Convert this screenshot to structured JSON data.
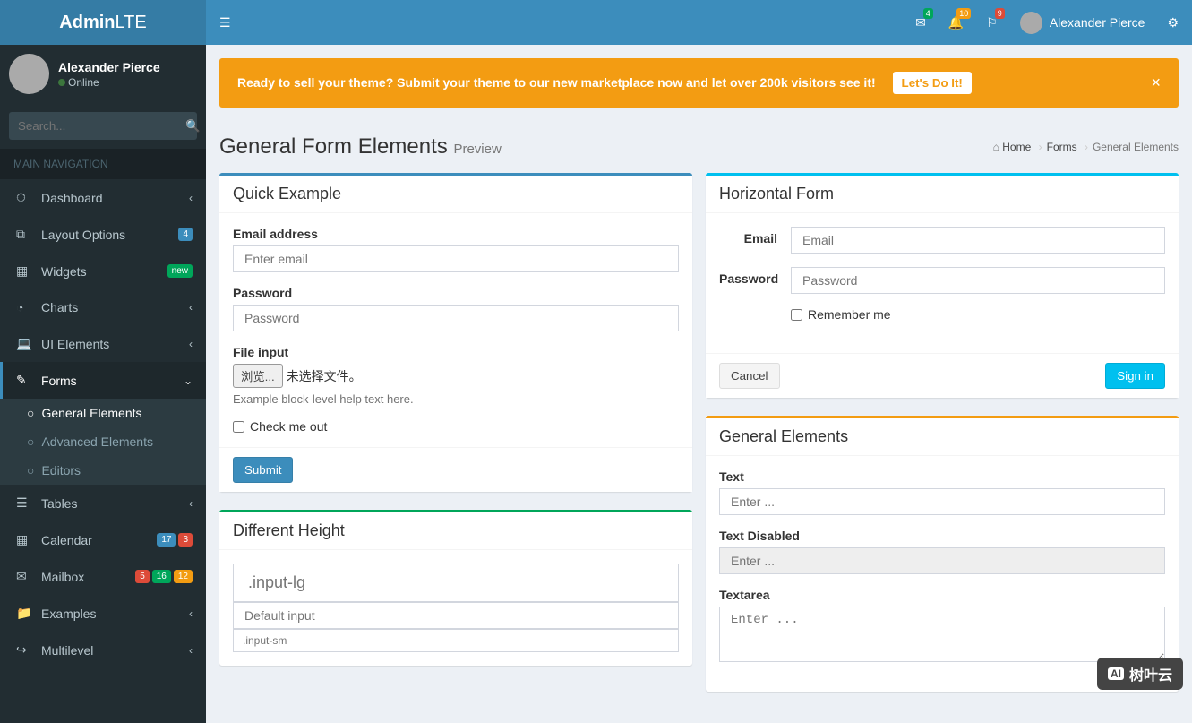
{
  "brand": {
    "prefix": "Admin",
    "suffix": "LTE"
  },
  "user": {
    "name": "Alexander Pierce",
    "status": "Online"
  },
  "search": {
    "placeholder": "Search..."
  },
  "nav_header": "MAIN NAVIGATION",
  "sidebar": {
    "items": [
      {
        "label": "Dashboard",
        "icon": "⚙"
      },
      {
        "label": "Layout Options",
        "icon": "⧉",
        "badge": "4",
        "badge_cls": "bg-blue"
      },
      {
        "label": "Widgets",
        "icon": "▦",
        "badge": "new",
        "badge_cls": "bg-green"
      },
      {
        "label": "Charts",
        "icon": "◔"
      },
      {
        "label": "UI Elements",
        "icon": "💻"
      },
      {
        "label": "Forms",
        "icon": "✎"
      },
      {
        "label": "Tables",
        "icon": "☰"
      },
      {
        "label": "Calendar",
        "icon": "📅",
        "badges": [
          [
            "17",
            "bg-blue"
          ],
          [
            "3",
            "bg-red"
          ]
        ]
      },
      {
        "label": "Mailbox",
        "icon": "✉",
        "badges": [
          [
            "5",
            "bg-red"
          ],
          [
            "16",
            "bg-green"
          ],
          [
            "12",
            "bg-yellow"
          ]
        ]
      },
      {
        "label": "Examples",
        "icon": "📁"
      },
      {
        "label": "Multilevel",
        "icon": "↪"
      }
    ],
    "forms_sub": [
      {
        "label": "General Elements"
      },
      {
        "label": "Advanced Elements"
      },
      {
        "label": "Editors"
      }
    ]
  },
  "topnav": {
    "mail_badge": "4",
    "bell_badge": "10",
    "flag_badge": "9",
    "username": "Alexander Pierce"
  },
  "alert": {
    "msg": "Ready to sell your theme? Submit your theme to our new marketplace now and let over 200k visitors see it!",
    "btn": "Let's Do It!"
  },
  "page": {
    "title": "General Form Elements",
    "subtitle": "Preview"
  },
  "breadcrumb": {
    "home": "Home",
    "forms": "Forms",
    "current": "General Elements"
  },
  "box_quick": {
    "title": "Quick Example",
    "email_label": "Email address",
    "email_ph": "Enter email",
    "pass_label": "Password",
    "pass_ph": "Password",
    "file_label": "File input",
    "file_btn": "浏览...",
    "file_status": "未选择文件。",
    "help": "Example block-level help text here.",
    "check": "Check me out",
    "submit": "Submit"
  },
  "box_height": {
    "title": "Different Height",
    "lg_ph": ".input-lg",
    "def_ph": "Default input",
    "sm_ph": ".input-sm"
  },
  "box_horiz": {
    "title": "Horizontal Form",
    "email_label": "Email",
    "email_ph": "Email",
    "pass_label": "Password",
    "pass_ph": "Password",
    "remember": "Remember me",
    "cancel": "Cancel",
    "signin": "Sign in"
  },
  "box_general": {
    "title": "General Elements",
    "text_label": "Text",
    "text_ph": "Enter ...",
    "disabled_label": "Text Disabled",
    "disabled_ph": "Enter ...",
    "textarea_label": "Textarea",
    "textarea_ph": "Enter ..."
  },
  "watermark": {
    "ai": "AI",
    "txt": "树叶云"
  }
}
